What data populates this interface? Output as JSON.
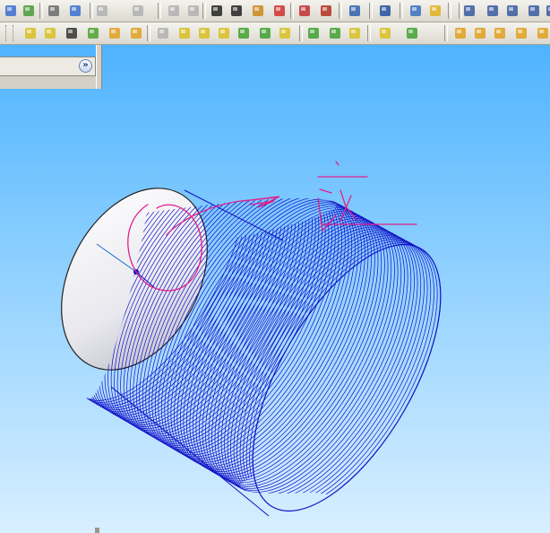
{
  "toolbar_row1": {
    "icons": [
      {
        "name": "rebuild-icon",
        "color": "#3c6fd0"
      },
      {
        "name": "options-icon",
        "color": "#4a9a3a"
      },
      {
        "name": "print-icon",
        "color": "#6a6a6a"
      },
      {
        "name": "print-preview-icon",
        "color": "#3c6fd0"
      },
      {
        "name": "undo-icon",
        "color": "#b0b0b0"
      },
      {
        "name": "redo-icon",
        "color": "#b0b0b0"
      },
      {
        "name": "copy-icon",
        "color": "#b0b0b0"
      },
      {
        "name": "paste-icon",
        "color": "#b0b0b0"
      },
      {
        "name": "select-icon",
        "color": "#222222"
      },
      {
        "name": "select-filter-icon",
        "color": "#222222"
      },
      {
        "name": "sketch-icon",
        "color": "#c98a1a"
      },
      {
        "name": "traffic-light-icon",
        "color": "#d03030"
      },
      {
        "name": "grid-icon",
        "color": "#c03030"
      },
      {
        "name": "brick-wall-icon",
        "color": "#b03020"
      },
      {
        "name": "camera-icon",
        "color": "#3060b0"
      },
      {
        "name": "tools-icon",
        "color": "#2050a0"
      },
      {
        "name": "list-icon",
        "color": "#3a70c0"
      },
      {
        "name": "help-icon",
        "color": "#e0b020"
      },
      {
        "name": "pin-icon",
        "color": "#3a5aa0"
      },
      {
        "name": "zoom-fit-icon",
        "color": "#3a5aa0"
      },
      {
        "name": "zoom-area-icon",
        "color": "#3a5aa0"
      },
      {
        "name": "zoom-in-out-icon",
        "color": "#3a5aa0"
      },
      {
        "name": "rotate-view-icon",
        "color": "#3a5aa0"
      }
    ]
  },
  "toolbar_row2": {
    "icons": [
      {
        "name": "view-orientation-icon",
        "color": "#d8c020"
      },
      {
        "name": "section-view-icon",
        "color": "#d8c020"
      },
      {
        "name": "move-view-icon",
        "color": "#333333"
      },
      {
        "name": "shaded-box-icon",
        "color": "#50a030"
      },
      {
        "name": "magnet-icon",
        "color": "#e0a020"
      },
      {
        "name": "arrow-down-icon",
        "color": "#e0a020"
      },
      {
        "name": "view-front-icon",
        "color": "#b0b0b0"
      },
      {
        "name": "wireframe-icon",
        "color": "#d8c020"
      },
      {
        "name": "hidden-lines-icon",
        "color": "#d8c020"
      },
      {
        "name": "shaded-edges-icon",
        "color": "#d8c020"
      },
      {
        "name": "shaded-icon",
        "color": "#40a030"
      },
      {
        "name": "green-box-icon",
        "color": "#40a030"
      },
      {
        "name": "perspective-icon",
        "color": "#d8c020"
      },
      {
        "name": "dot-grid-icon",
        "color": "#40a030"
      },
      {
        "name": "link-icon",
        "color": "#40a030"
      },
      {
        "name": "clipboard-icon",
        "color": "#d8c020"
      },
      {
        "name": "lights-icon",
        "color": "#d8c020"
      },
      {
        "name": "spiral-icon",
        "color": "#40a030"
      },
      {
        "name": "diamond-icon",
        "color": "#e0a020"
      },
      {
        "name": "arch-icon",
        "color": "#e0a020"
      },
      {
        "name": "horseshoe-icon",
        "color": "#e0a020"
      },
      {
        "name": "down-arrow-icon",
        "color": "#e0a020"
      },
      {
        "name": "cube-icon",
        "color": "#e0a020"
      }
    ]
  },
  "panel": {
    "expand_label": "»"
  },
  "viewport": {
    "background_top": "#4fb3ff",
    "background_bottom": "#d8efff",
    "part": "cylinder-with-helix",
    "helix_color": "#1010c8",
    "face_color": "#ffffff",
    "annotation_color": "#e0208a"
  }
}
